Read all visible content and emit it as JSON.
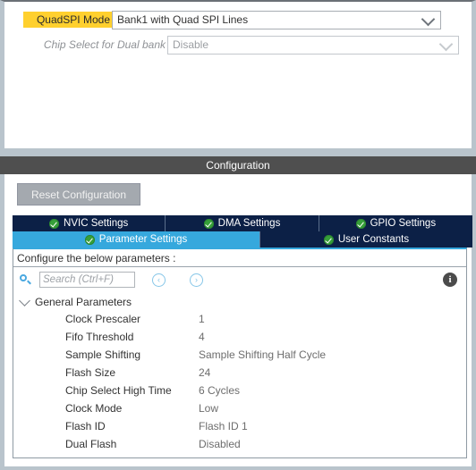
{
  "mode_panel": {
    "rows": [
      {
        "label": "QuadSPI Mode",
        "value": "Bank1 with Quad SPI Lines",
        "highlight_color": "#ffd02e",
        "state": "enabled",
        "chevron_icon": "chevron-down-icon"
      },
      {
        "label": "Chip Select for Dual bank",
        "value": "Disable",
        "state": "disabled",
        "chevron_icon": "chevron-down-icon"
      }
    ]
  },
  "configuration": {
    "header_title": "Configuration",
    "reset_button": "Reset Configuration",
    "tabs_row1": [
      {
        "label": "NVIC Settings",
        "icon": "check-circle-icon",
        "active": false
      },
      {
        "label": "DMA Settings",
        "icon": "check-circle-icon",
        "active": false
      },
      {
        "label": "GPIO Settings",
        "icon": "check-circle-icon",
        "active": false
      }
    ],
    "tabs_row2": [
      {
        "label": "Parameter Settings",
        "icon": "check-circle-icon",
        "active": true
      },
      {
        "label": "User Constants",
        "icon": "check-circle-icon",
        "active": false
      }
    ],
    "active_tab_color": "#36a8dd",
    "tab_color": "#0c2046"
  },
  "panel": {
    "configure_text": "Configure the below parameters :",
    "search": {
      "icon": "search-icon",
      "placeholder": "Search (Ctrl+F)",
      "value": ""
    },
    "nav_back_label": "‹",
    "nav_forward_label": "›",
    "info_label": "i"
  },
  "parameters": {
    "group_label": "General Parameters",
    "rows": [
      {
        "name": "Clock Prescaler",
        "value": "1"
      },
      {
        "name": "Fifo Threshold",
        "value": "4"
      },
      {
        "name": "Sample Shifting",
        "value": "Sample Shifting Half Cycle"
      },
      {
        "name": "Flash Size",
        "value": "24"
      },
      {
        "name": "Chip Select High Time",
        "value": "6 Cycles"
      },
      {
        "name": "Clock Mode",
        "value": "Low"
      },
      {
        "name": "Flash ID",
        "value": "Flash ID 1"
      },
      {
        "name": "Dual Flash",
        "value": "Disabled"
      }
    ]
  }
}
